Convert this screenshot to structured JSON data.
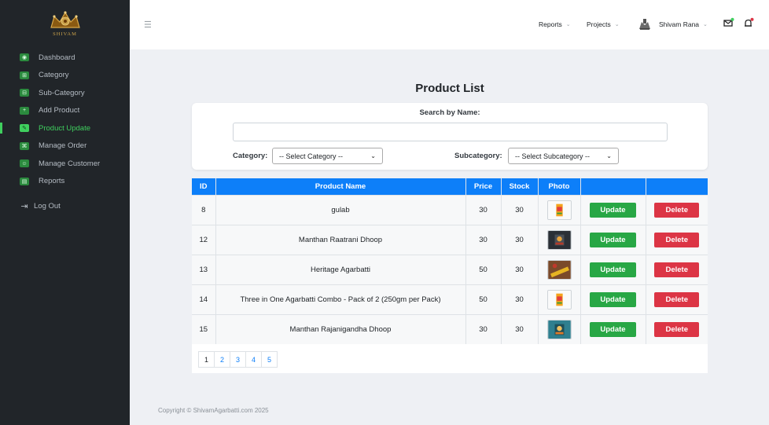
{
  "brand": {
    "logo_text": "SHIVAM"
  },
  "sidebar": {
    "items": [
      {
        "label": "Dashboard",
        "icon": "dashboard-icon",
        "glyph": "◉",
        "active": false
      },
      {
        "label": "Category",
        "icon": "category-icon",
        "glyph": "⊞",
        "active": false
      },
      {
        "label": "Sub-Category",
        "icon": "subcategory-icon",
        "glyph": "⊟",
        "active": false
      },
      {
        "label": "Add Product",
        "icon": "add-product-icon",
        "glyph": "+",
        "active": false
      },
      {
        "label": "Product Update",
        "icon": "wrench-icon",
        "glyph": "✎",
        "active": true
      },
      {
        "label": "Manage Order",
        "icon": "order-icon",
        "glyph": "⌘",
        "active": false
      },
      {
        "label": "Manage Customer",
        "icon": "customer-icon",
        "glyph": "☺",
        "active": false
      },
      {
        "label": "Reports",
        "icon": "reports-icon",
        "glyph": "▤",
        "active": false
      }
    ],
    "logout": {
      "label": "Log Out",
      "icon": "logout-icon",
      "glyph": "⇥"
    }
  },
  "header": {
    "menu_icon": "hamburger-icon",
    "reports_label": "Reports",
    "projects_label": "Projects",
    "user_name": "Shivam Rana",
    "mail_icon": "mail-icon",
    "bell_icon": "bell-icon"
  },
  "main": {
    "title": "Product List",
    "search": {
      "label": "Search by Name:",
      "value": "",
      "placeholder": ""
    },
    "category_filter": {
      "label": "Category:",
      "selected": "-- Select Category --"
    },
    "subcategory_filter": {
      "label": "Subcategory:",
      "selected": "-- Select Subcategory --"
    },
    "table": {
      "columns": [
        "ID",
        "Product Name",
        "Price",
        "Stock",
        "Photo",
        "",
        ""
      ],
      "rows": [
        {
          "id": "8",
          "name": "gulab",
          "price": "30",
          "stock": "30",
          "thumb": "product-photo"
        },
        {
          "id": "12",
          "name": "Manthan Raatrani Dhoop",
          "price": "30",
          "stock": "30",
          "thumb": "product-photo"
        },
        {
          "id": "13",
          "name": "Heritage Agarbatti",
          "price": "50",
          "stock": "30",
          "thumb": "product-photo"
        },
        {
          "id": "14",
          "name": "Three in One Agarbatti Combo - Pack of 2 (250gm per Pack)",
          "price": "50",
          "stock": "30",
          "thumb": "product-photo"
        },
        {
          "id": "15",
          "name": "Manthan Rajanigandha Dhoop",
          "price": "30",
          "stock": "30",
          "thumb": "product-photo"
        }
      ],
      "update_label": "Update",
      "delete_label": "Delete"
    },
    "pagination": {
      "pages": [
        "1",
        "2",
        "3",
        "4",
        "5"
      ],
      "current": "1"
    }
  },
  "footer": {
    "copyright": "Copyright © ShivamAgarbatti.com 2025"
  },
  "colors": {
    "sidebar_bg": "#212529",
    "accent_green": "#3fcf5e",
    "table_header": "#0d7ff9",
    "update_button": "#28a745",
    "delete_button": "#dc3545"
  }
}
